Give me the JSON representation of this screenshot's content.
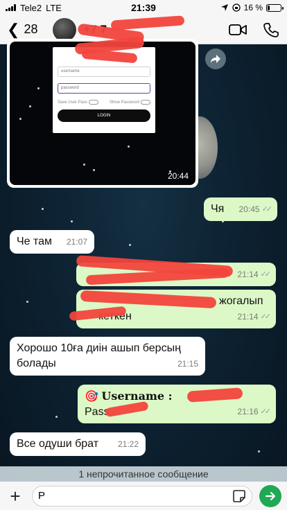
{
  "status_bar": {
    "carrier": "Tele2",
    "network": "LTE",
    "time": "21:39",
    "battery": "16 %",
    "battery_level": 0.16
  },
  "header": {
    "back_count": "28",
    "contact_name": "+7 7",
    "icons": [
      "video-icon",
      "phone-icon"
    ]
  },
  "image_message": {
    "time": "20:44",
    "screenshot": {
      "username_placeholder": "username",
      "password_label": "password",
      "save_user_pass": "Save User Pass",
      "show_password": "Show Password",
      "login_button": "LOGIN"
    }
  },
  "messages": [
    {
      "id": "m1",
      "direction": "out",
      "text": "Чя",
      "time": "20:45",
      "read": true
    },
    {
      "id": "m2",
      "direction": "in",
      "text": "Че там",
      "time": "21:07"
    },
    {
      "id": "m3",
      "direction": "out",
      "text": "",
      "time": "21:14",
      "read": true
    },
    {
      "id": "m4",
      "direction": "out",
      "text_visible": "жогалып",
      "text_line2": "кеткен",
      "time": "21:14",
      "read": true
    },
    {
      "id": "m5",
      "direction": "in",
      "text": "Хорошо 10ға диін ашып берсың",
      "text_line2": "болады",
      "time": "21:15"
    },
    {
      "id": "m6",
      "direction": "out",
      "emoji": "🎯",
      "text": "Username :",
      "text_line2": "Pass",
      "time": "21:16",
      "read": true
    },
    {
      "id": "m7",
      "direction": "in",
      "text": "Все одуши брат",
      "time": "21:22"
    }
  ],
  "unread_banner": "1 непрочитанное сообщение",
  "composer": {
    "value": "Р"
  },
  "colors": {
    "outgoing_bubble": "#dcf8c6",
    "incoming_bubble": "#ffffff",
    "send_button": "#1fa855",
    "redaction": "#f2453c"
  }
}
